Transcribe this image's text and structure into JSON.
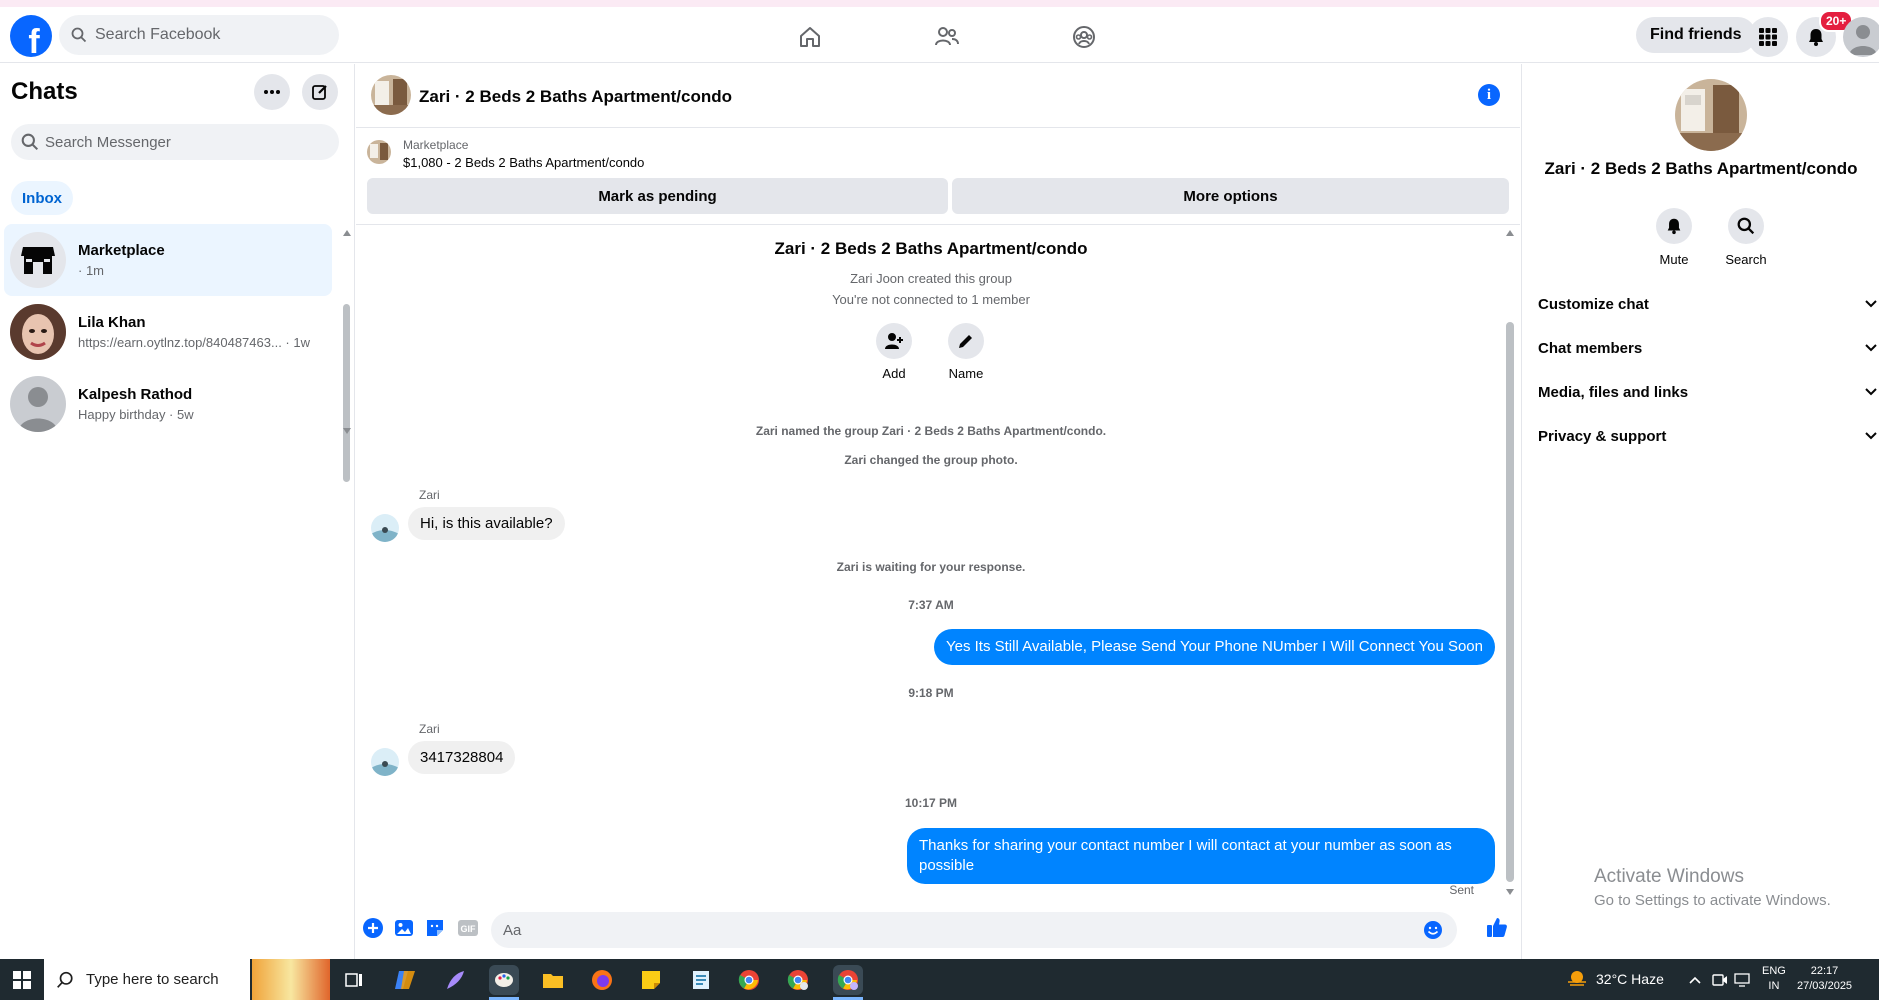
{
  "topnav": {
    "logo": "f",
    "search_placeholder": "Search Facebook",
    "find_friends": "Find friends",
    "notif_count": "20+",
    "icons": [
      "home-icon",
      "friends-icon",
      "groups-icon",
      "menu-grid-icon",
      "bell-icon"
    ]
  },
  "left": {
    "title": "Chats",
    "search_placeholder": "Search Messenger",
    "inbox": "Inbox",
    "chats": [
      {
        "name": "Marketplace",
        "sub": "· 1m",
        "active": true
      },
      {
        "name": "Lila Khan",
        "sub": "https://earn.oytlnz.top/840487463... · 1w",
        "active": false
      },
      {
        "name": "Kalpesh Rathod",
        "sub": "Happy birthday · 5w",
        "active": false
      }
    ]
  },
  "conversation": {
    "title": "Zari · 2 Beds 2 Baths Apartment/condo",
    "marketplace_label": "Marketplace",
    "listing": "$1,080 - 2 Beds 2 Baths Apartment/condo",
    "mark_pending": "Mark as pending",
    "more_options": "More options",
    "group_title": "Zari · 2 Beds 2 Baths Apartment/condo",
    "created": "Zari Joon created this group",
    "not_connected": "You're not connected to 1 member",
    "add": "Add",
    "name": "Name",
    "sys1": "Zari named the group Zari · 2 Beds 2 Baths Apartment/condo.",
    "sys2": "Zari changed the group photo.",
    "sender": "Zari",
    "msg1": "Hi, is this available?",
    "waiting": "Zari is waiting for your response.",
    "time1": "7:37 AM",
    "out1": "Yes Its Still Available, Please Send Your Phone NUmber I Will Connect You Soon",
    "time2": "9:18 PM",
    "msg2": "3417328804",
    "time3": "10:17 PM",
    "out2": "Thanks for sharing your contact number I will contact at your number as soon as possible",
    "sent": "Sent",
    "composer_placeholder": "Aa"
  },
  "right": {
    "title": "Zari · 2 Beds 2 Baths Apartment/condo",
    "mute": "Mute",
    "search": "Search",
    "sections": [
      "Customize chat",
      "Chat members",
      "Media, files and links",
      "Privacy & support"
    ]
  },
  "watermark": {
    "line1": "Activate Windows",
    "line2": "Go to Settings to activate Windows."
  },
  "taskbar": {
    "search": "Type here to search",
    "weather": "32°C  Haze",
    "lang1": "ENG",
    "lang2": "IN",
    "time": "22:17",
    "date": "27/03/2025"
  }
}
